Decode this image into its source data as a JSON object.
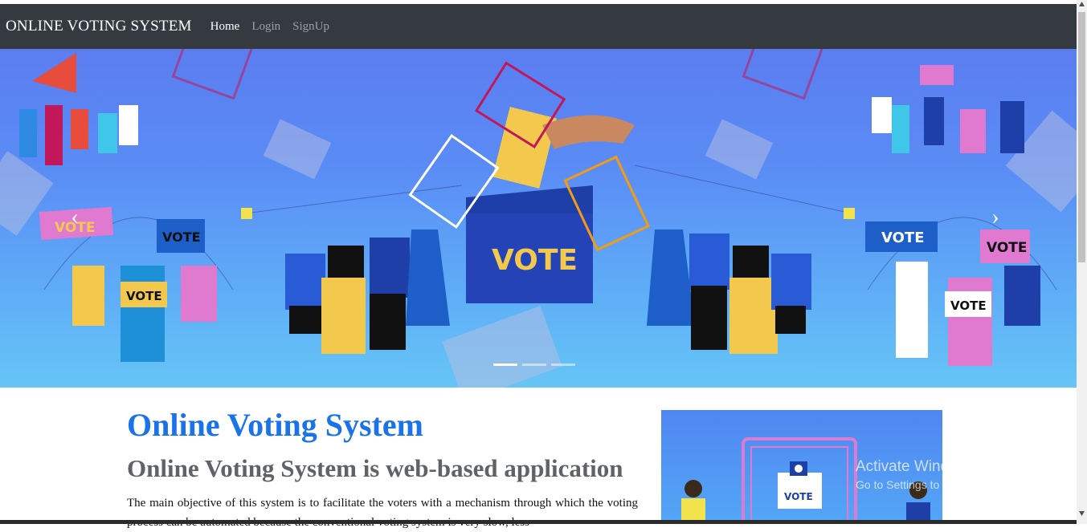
{
  "navbar": {
    "brand": "ONLINE VOTING SYSTEM",
    "links": [
      "Home",
      "Login",
      "SignUp"
    ],
    "background": "#343a40"
  },
  "carousel": {
    "vote_labels": [
      "VOTE",
      "VOTE",
      "VOTE",
      "VOTE",
      "VOTE",
      "VOTE"
    ],
    "ballot_box_label": "VOTE",
    "slide_count": 3,
    "active_slide": 1,
    "prev_icon": "chevron-left-icon",
    "next_icon": "chevron-right-icon"
  },
  "content": {
    "title": "Online Voting System",
    "subtitle": "Online Voting System is web-based application",
    "description": "The main objective of this system is to facilitate the voters with a mechanism through which the voting process can be automated because the conventional voting system is very slow, less"
  },
  "side_image": {
    "vote_label": "VOTE"
  },
  "watermark": {
    "line1": "Activate Windows",
    "line2": "Go to Settings to activate Windows."
  },
  "colors": {
    "title_blue": "#1a73e8",
    "subtitle_gray": "#5f6368",
    "banner_blue": "#5b7df0"
  }
}
